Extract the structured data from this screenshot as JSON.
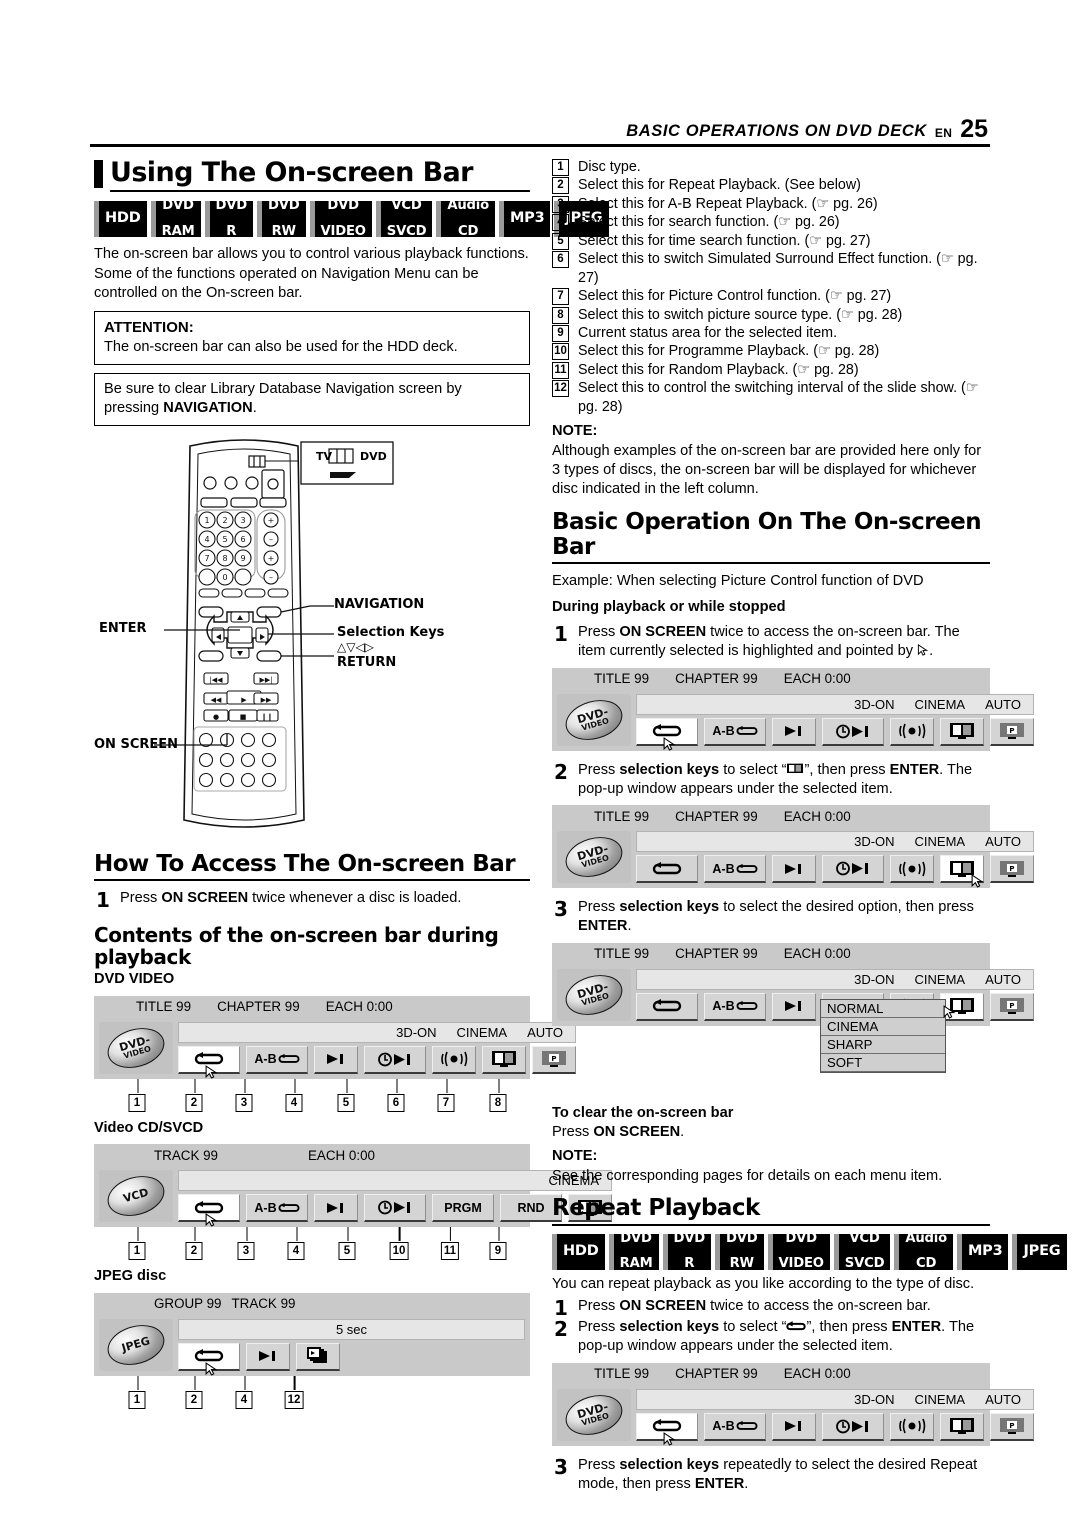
{
  "header": {
    "title": "BASIC OPERATIONS ON DVD DECK",
    "lang": "EN",
    "page": "25"
  },
  "left": {
    "heading": "Using The On-screen Bar",
    "badges": [
      {
        "l1": "HDD",
        "l2": ""
      },
      {
        "l1": "DVD",
        "l2": "RAM"
      },
      {
        "l1": "DVD",
        "l2": "R"
      },
      {
        "l1": "DVD",
        "l2": "RW"
      },
      {
        "l1": "DVD",
        "l2": "VIDEO"
      },
      {
        "l1": "VCD",
        "l2": "SVCD"
      },
      {
        "l1": "Audio",
        "l2": "CD"
      },
      {
        "l1": "MP3",
        "l2": ""
      },
      {
        "l1": "JPEG",
        "l2": ""
      }
    ],
    "intro": "The on-screen bar allows you to control various playback functions. Some of the functions operated on Navigation Menu can be controlled on the On-screen bar.",
    "attention_label": "ATTENTION:",
    "attention_text": "The on-screen bar can also be used for the HDD deck.",
    "navnote_text": "Be sure to clear Library Database Navigation screen by pressing",
    "navnote_bold": "NAVIGATION",
    "navnote_end": ".",
    "remote_labels": {
      "tv": "TV",
      "dvd": "DVD",
      "navigation": "NAVIGATION",
      "enter": "ENTER",
      "selection_keys": "Selection Keys",
      "selection_arrows": "△▽◁▷",
      "return": "RETURN",
      "on_screen": "ON SCREEN"
    },
    "howto_heading": "How To Access The On-screen Bar",
    "howto_step1_num": "1",
    "howto_step1_a": "Press ",
    "howto_step1_b": "ON SCREEN",
    "howto_step1_c": " twice whenever a disc is loaded.",
    "contents_heading": "Contents of the on-screen bar during playback",
    "dvd_video_label": "DVD VIDEO",
    "vcd_label": "Video CD/SVCD",
    "jpeg_label": "JPEG disc"
  },
  "bars": {
    "dvd_video": {
      "disc_l1": "DVD-",
      "disc_l2": "VIDEO",
      "top": [
        "TITLE 99",
        "CHAPTER 99",
        "EACH 0:00"
      ],
      "status": [
        "3D-ON",
        "CINEMA",
        "AUTO"
      ],
      "icons": [
        "repeat-icon",
        "ab-repeat-icon",
        "search-icon",
        "time-search-icon",
        "surround-icon",
        "picture-control-icon",
        "picture-source-icon"
      ],
      "ab_label": "A-B",
      "callouts": [
        "1",
        "2",
        "3",
        "4",
        "5",
        "6",
        "7",
        "8"
      ]
    },
    "vcd": {
      "disc_l1": "VCD",
      "disc_l2": "",
      "top": [
        "TRACK 99",
        "EACH 0:00"
      ],
      "status": [
        "CINEMA"
      ],
      "prgm_label": "PRGM",
      "rnd_label": "RND",
      "ab_label": "A-B",
      "callouts": [
        "1",
        "2",
        "3",
        "4",
        "5",
        "10",
        "11",
        "9"
      ]
    },
    "jpeg": {
      "disc_l1": "JPEG",
      "disc_l2": "",
      "top": [
        "GROUP 99",
        "TRACK 99"
      ],
      "status_center": "5 sec",
      "callouts": [
        "1",
        "2",
        "4",
        "12"
      ]
    }
  },
  "right": {
    "items": [
      {
        "n": "1",
        "text": "Disc type."
      },
      {
        "n": "2",
        "text": "Select this for Repeat Playback. (See below)"
      },
      {
        "n": "3",
        "text": "Select this for A-B Repeat Playback. (☞ pg. 26)"
      },
      {
        "n": "4",
        "text": "Select this for search function. (☞ pg. 26)"
      },
      {
        "n": "5",
        "text": "Select this for time search function. (☞ pg. 27)"
      },
      {
        "n": "6",
        "text": "Select this to switch Simulated Surround Effect function. (☞ pg. 27)"
      },
      {
        "n": "7",
        "text": "Select this for Picture Control function. (☞ pg. 27)"
      },
      {
        "n": "8",
        "text": "Select this to switch picture source type. (☞ pg. 28)"
      },
      {
        "n": "9",
        "text": "Current status area for the selected item."
      },
      {
        "n": "10",
        "text": "Select this for Programme Playback. (☞ pg. 28)"
      },
      {
        "n": "11",
        "text": "Select this for Random Playback. (☞ pg. 28)"
      },
      {
        "n": "12",
        "text": "Select this to control the switching interval of the slide show. (☞ pg. 28)"
      }
    ],
    "note_label": "NOTE:",
    "note_text": "Although examples of the on-screen bar are provided here only for 3 types of discs, the on-screen bar will be displayed for whichever disc indicated in the left column.",
    "basic_heading": "Basic Operation On The On-screen Bar",
    "example": "Example: When selecting Picture Control function of DVD",
    "during_label": "During playback or while stopped",
    "step1": {
      "n": "1",
      "a": "Press ",
      "b": "ON SCREEN",
      "c": " twice to access the on-screen bar. The item currently selected is highlighted and pointed by ",
      "d": "."
    },
    "step2": {
      "n": "2",
      "a": "Press ",
      "b": "selection keys",
      "c": " to select “",
      "d": "”, then press ",
      "e": "ENTER",
      "f": ". The pop-up window appears under the selected item."
    },
    "step3": {
      "n": "3",
      "a": "Press ",
      "b": "selection keys",
      "c": " to select the desired option, then press ",
      "d": "ENTER",
      "e": "."
    },
    "popup_options": [
      "NORMAL",
      "CINEMA",
      "SHARP",
      "SOFT"
    ],
    "clear_label": "To clear the on-screen bar",
    "clear_a": "Press ",
    "clear_b": "ON SCREEN",
    "clear_c": ".",
    "note2_label": "NOTE:",
    "note2_text": "See the corresponding pages for details on each menu item.",
    "repeat_heading": "Repeat Playback",
    "repeat_intro": "You can repeat playback as you like according to the type of disc.",
    "rstep1": {
      "n": "1",
      "a": "Press ",
      "b": "ON SCREEN",
      "c": " twice to access the on-screen bar."
    },
    "rstep2": {
      "n": "2",
      "a": "Press ",
      "b": "selection keys",
      "c": " to select “",
      "d": "”, then press ",
      "e": "ENTER",
      "f": ". The pop-up window appears under the selected item."
    },
    "rstep3": {
      "n": "3",
      "a": "Press ",
      "b": "selection keys",
      "c": " repeatedly to select the desired Repeat mode, then press ",
      "d": "ENTER",
      "e": "."
    }
  },
  "colors": {
    "bar_bg": "#c9c9c9",
    "status_bg": "#e6e6e6",
    "icon_bg": "#d4d4d4",
    "selected_bg": "#ffffff"
  }
}
